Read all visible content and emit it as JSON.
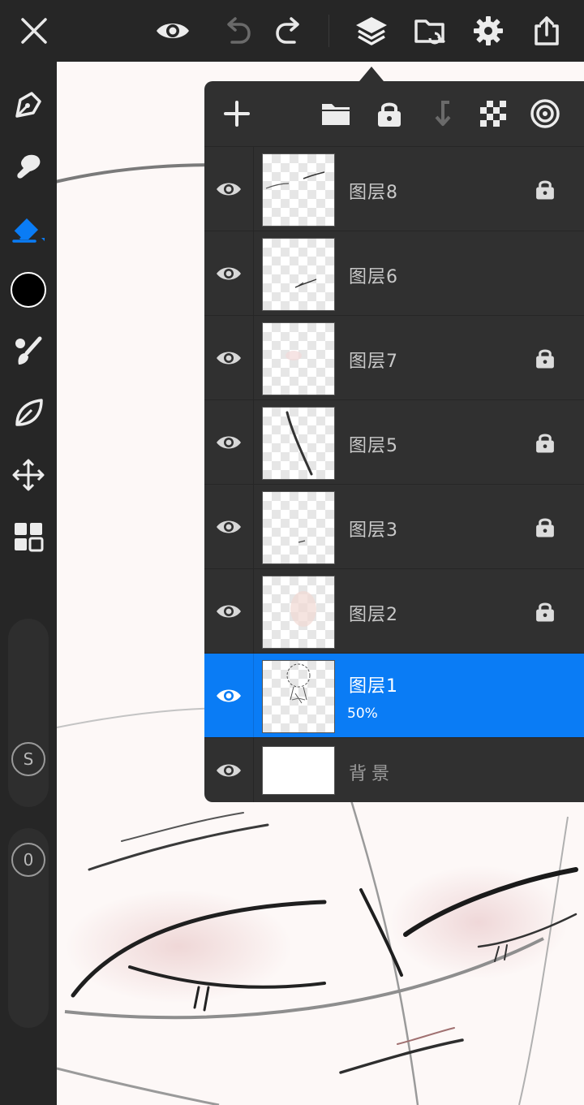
{
  "colors": {
    "accent": "#0a7cf5",
    "brush_color": "#000000",
    "panel_bg": "#303030",
    "toolbar_bg": "#262626"
  },
  "top_toolbar": {
    "icons": [
      "close-icon",
      "eye-icon",
      "undo-icon",
      "redo-icon",
      "layers-icon",
      "gallery-icon",
      "gear-icon",
      "share-icon"
    ]
  },
  "left_toolbar": {
    "icons": [
      "pen-icon",
      "smudge-icon",
      "eraser-icon",
      "color-swatch",
      "brush-library-icon",
      "leaf-icon",
      "move-icon",
      "grid-icon"
    ],
    "size_slider_label": "S",
    "opacity_slider_label": "0"
  },
  "layers_panel": {
    "toolbar_icons": [
      "plus-icon",
      "folder-icon",
      "lock-icon",
      "merge-down-icon",
      "checkerboard-icon",
      "target-icon"
    ],
    "layers": [
      {
        "name": "图层8",
        "locked": true,
        "selected": false,
        "opacity": null
      },
      {
        "name": "图层6",
        "locked": false,
        "selected": false,
        "opacity": null
      },
      {
        "name": "图层7",
        "locked": true,
        "selected": false,
        "opacity": null
      },
      {
        "name": "图层5",
        "locked": true,
        "selected": false,
        "opacity": null
      },
      {
        "name": "图层3",
        "locked": true,
        "selected": false,
        "opacity": null
      },
      {
        "name": "图层2",
        "locked": true,
        "selected": false,
        "opacity": null
      },
      {
        "name": "图层1",
        "locked": false,
        "selected": true,
        "opacity": "50%"
      },
      {
        "name": "背景",
        "locked": false,
        "selected": false,
        "opacity": null
      }
    ]
  }
}
